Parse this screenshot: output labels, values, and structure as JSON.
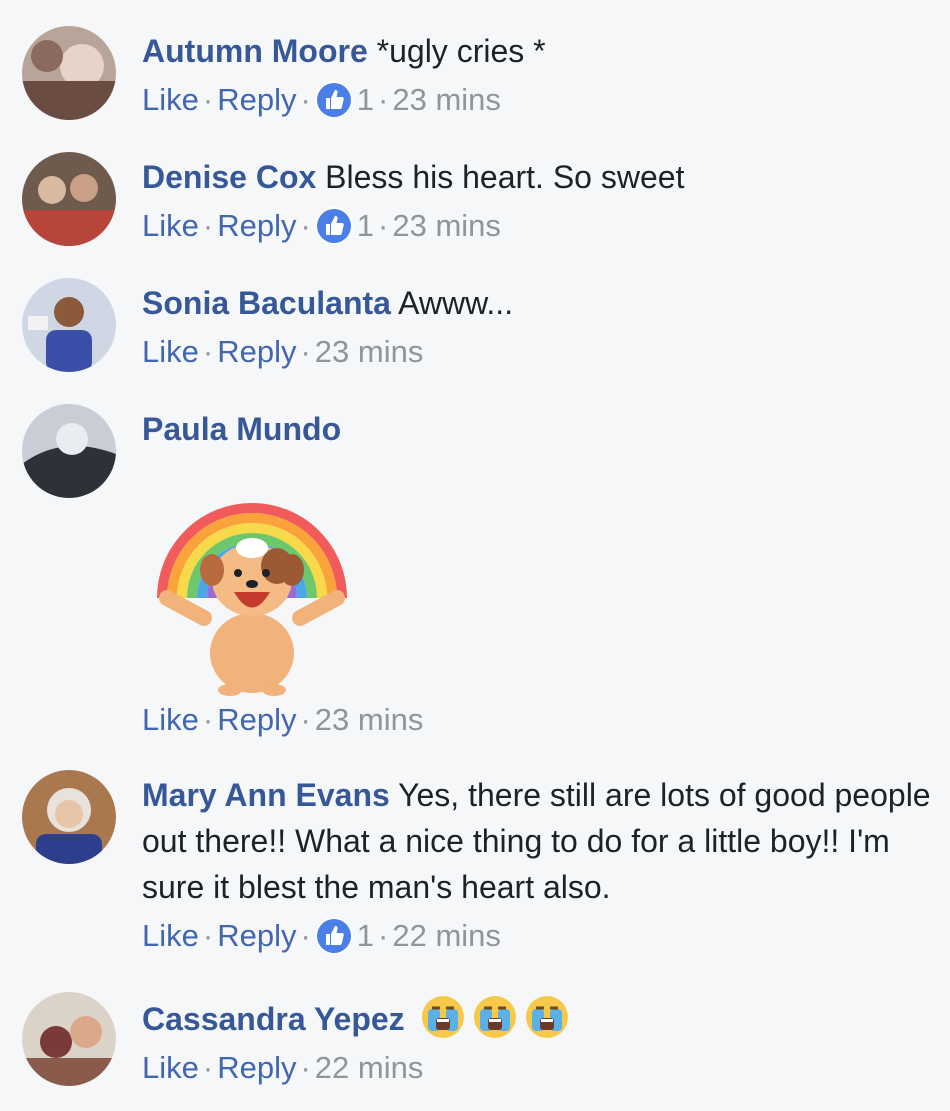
{
  "actions": {
    "like": "Like",
    "reply": "Reply"
  },
  "comments": [
    {
      "name": "Autumn Moore",
      "text": "*ugly cries *",
      "likes": "1",
      "time": "23 mins"
    },
    {
      "name": "Denise Cox",
      "text": "Bless his heart. So sweet",
      "likes": "1",
      "time": "23 mins"
    },
    {
      "name": "Sonia Baculanta",
      "text": "Awww...",
      "time": "23 mins"
    },
    {
      "name": "Paula Mundo",
      "sticker": "rainbow-puppy-sticker",
      "time": "23 mins"
    },
    {
      "name": "Mary Ann Evans",
      "text": "Yes, there still are lots of good people out there!! What a nice thing to do for a little boy!! I'm sure it blest the man's heart also.",
      "likes": "1",
      "time": "22 mins"
    },
    {
      "name": "Cassandra Yepez",
      "emoji": [
        "crying-face-emoji",
        "crying-face-emoji",
        "crying-face-emoji"
      ],
      "time": "22 mins"
    }
  ],
  "colors": {
    "name": "#365899",
    "link": "#4267b2",
    "meta": "#90949c",
    "like_badge": "#4a7fe8",
    "background": "#f6f7f9"
  }
}
